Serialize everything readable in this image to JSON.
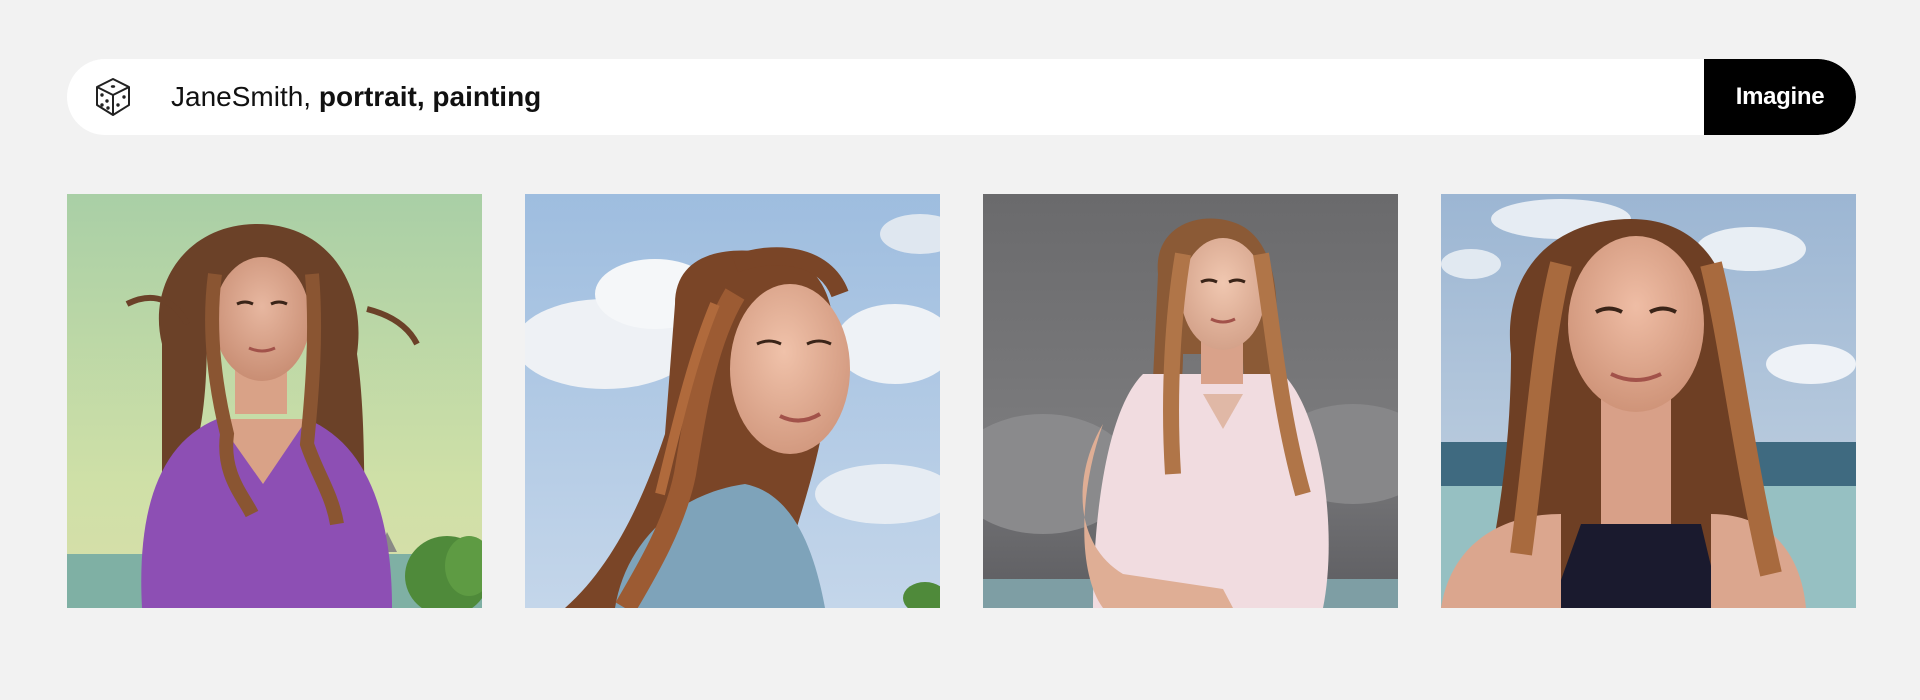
{
  "prompt": {
    "dice_icon": "dice-icon",
    "user_tag": "JaneSmith,",
    "keywords": "portrait, painting"
  },
  "actions": {
    "imagine_label": "Imagine"
  },
  "colors": {
    "background": "#f2f2f2",
    "button": "#000000",
    "button_text": "#ffffff"
  },
  "gallery": {
    "images": [
      {
        "subject": "young woman, long brown hair, purple sweater",
        "backdrop": "pale green sky, sea, trees"
      },
      {
        "subject": "young woman smiling, blue top",
        "backdrop": "blue sky with clouds"
      },
      {
        "subject": "young woman, white polo shirt",
        "backdrop": "grey stormy sky, sea"
      },
      {
        "subject": "young woman smiling, dark top",
        "backdrop": "cloudy sky, sea"
      }
    ]
  }
}
